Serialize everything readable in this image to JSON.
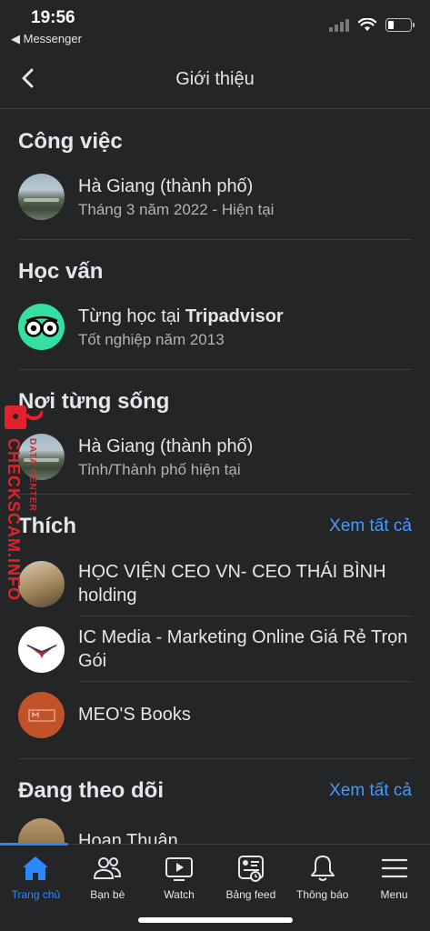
{
  "status_bar": {
    "time": "19:56",
    "back_label": "◀ Messenger"
  },
  "header": {
    "title": "Giới thiệu"
  },
  "work": {
    "title": "Công việc",
    "items": [
      {
        "title": "Hà Giang (thành phố)",
        "subtitle": "Tháng 3 năm 2022 - Hiện tại"
      }
    ]
  },
  "education": {
    "title": "Học vấn",
    "items": [
      {
        "title_prefix": "Từng học tại ",
        "title_bold": "Tripadvisor",
        "subtitle": "Tốt nghiệp năm 2013"
      }
    ]
  },
  "lived": {
    "title": "Nơi từng sống",
    "items": [
      {
        "title": "Hà Giang (thành phố)",
        "subtitle": "Tỉnh/Thành phố hiện tại"
      }
    ]
  },
  "likes": {
    "title": "Thích",
    "see_all": "Xem tất cả",
    "items": [
      {
        "title": "HỌC VIỆN CEO VN- CEO THÁI BÌNH holding"
      },
      {
        "title": "IC Media - Marketing Online Giá Rẻ Trọn Gói"
      },
      {
        "title": "MEO'S Books"
      }
    ]
  },
  "following": {
    "title": "Đang theo dõi",
    "see_all": "Xem tất cả",
    "items": [
      {
        "title": "Hoan Thuân"
      }
    ]
  },
  "watermark": {
    "main": "CHECKSCAM.INFO",
    "small": "DATA CENTER"
  },
  "tabs": [
    {
      "label": "Trang chủ",
      "icon": "home-icon",
      "active": true
    },
    {
      "label": "Bạn bè",
      "icon": "friends-icon"
    },
    {
      "label": "Watch",
      "icon": "watch-icon"
    },
    {
      "label": "Bảng feed",
      "icon": "feed-icon"
    },
    {
      "label": "Thông báo",
      "icon": "bell-icon"
    },
    {
      "label": "Menu",
      "icon": "menu-icon"
    }
  ],
  "colors": {
    "accent": "#2d88ff",
    "link": "#4599ff",
    "background": "#242526",
    "watermark": "#e0232b"
  }
}
